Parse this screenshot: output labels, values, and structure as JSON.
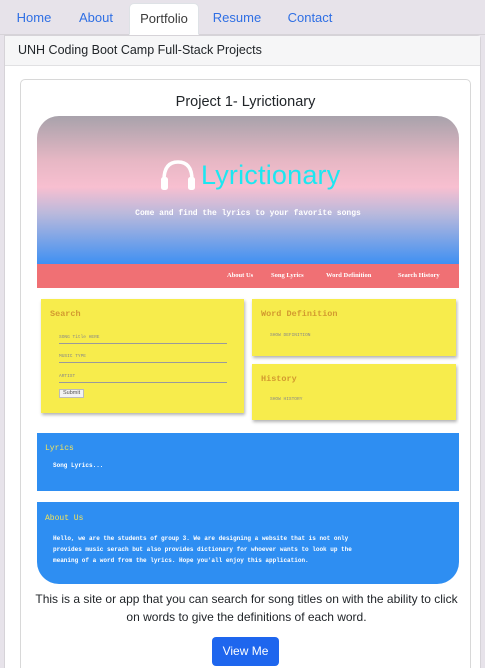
{
  "nav": {
    "items": [
      {
        "label": "Home",
        "active": false
      },
      {
        "label": "About",
        "active": false
      },
      {
        "label": "Portfolio",
        "active": true
      },
      {
        "label": "Resume",
        "active": false
      },
      {
        "label": "Contact",
        "active": false
      }
    ]
  },
  "card": {
    "header": "UNH Coding Boot Camp Full-Stack Projects",
    "project": {
      "title": "Project 1- Lyrictionary",
      "description": "This is a site or app that you can search for song titles on with the ability to click on words to give the definitions of each word.",
      "button_label": "View Me",
      "screenshot": {
        "hero_title": "Lyrictionary",
        "hero_subtitle": "Come and find the lyrics to your favorite songs",
        "nav": [
          "About Us",
          "Song Lyrics",
          "Word Definition",
          "Search History"
        ],
        "search": {
          "title": "Search",
          "fields": [
            "SONG Title HERE",
            "MUSIC TYPE",
            "ARTIST"
          ],
          "submit": "Submit"
        },
        "word_definition": {
          "title": "Word Definition",
          "link": "SHOW DEFINITION"
        },
        "history": {
          "title": "History",
          "link": "SHOW HISTORY"
        },
        "lyrics": {
          "title": "Lyrics",
          "text": "Song Lyrics..."
        },
        "about": {
          "title": "About Us",
          "lines": [
            "Hello, we are the students of group 3. We are designing a website that is not only",
            "provides music serach but also provides dictionary for whoever wants to look up the",
            "meaning of a word from the lyrics. Hope you'all enjoy this application."
          ]
        }
      }
    }
  },
  "colors": {
    "link": "#2f6fe4",
    "button": "#1e66ee",
    "hero_title": "#1ce7f1",
    "mini_nav": "#f07074",
    "yellow_box": "#f7ec4c",
    "blue_section": "#2e8ef2"
  }
}
